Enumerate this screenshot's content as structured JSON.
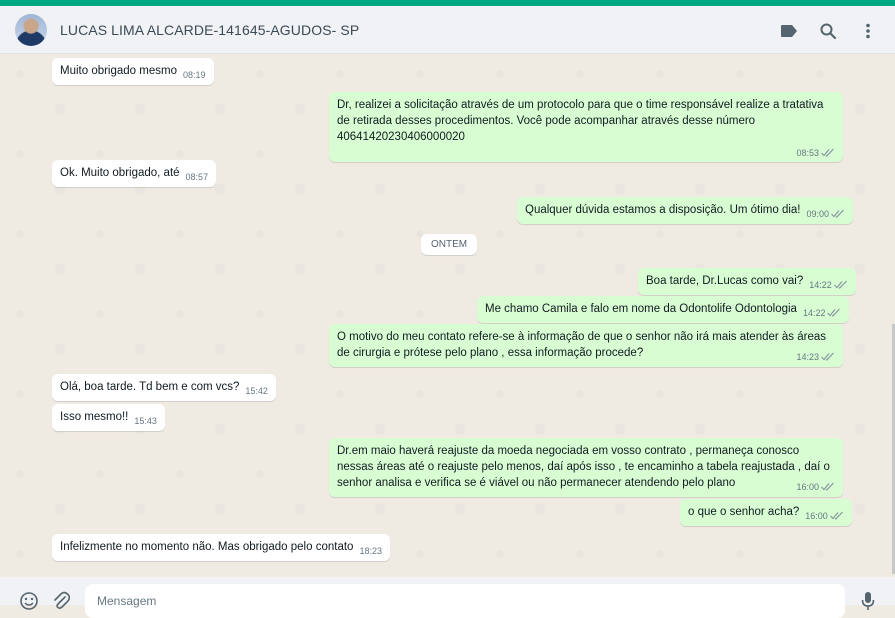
{
  "app": {
    "accent_color": "#00a884",
    "outgoing_bubble_color": "#d9fdd3",
    "incoming_bubble_color": "#ffffff"
  },
  "header": {
    "contact_name": "LUCAS LIMA ALCARDE-141645-AGUDOS- SP",
    "icons": [
      "label-icon",
      "search-icon",
      "menu-dots-icon"
    ]
  },
  "date_separator": "ONTEM",
  "messages": [
    {
      "direction": "in",
      "text": "Muito obrigado mesmo",
      "time": "08:19"
    },
    {
      "direction": "out",
      "text": "Dr, realizei a solicitação através de um protocolo para que o time responsável realize a tratativa de retirada desses procedimentos. Você pode acompanhar através desse número 40641420230406000020",
      "time": "08:53",
      "status": "read"
    },
    {
      "direction": "in",
      "text": "Ok. Muito obrigado, até",
      "time": "08:57"
    },
    {
      "direction": "out",
      "text": "Qualquer dúvida estamos a disposição. Um ótimo dia!",
      "time": "09:00",
      "status": "read"
    },
    {
      "direction": "out",
      "text": "Boa tarde, Dr.Lucas como vai?",
      "time": "14:22",
      "status": "read"
    },
    {
      "direction": "out",
      "text": "Me chamo Camila e falo em nome da Odontolife Odontologia",
      "time": "14:22",
      "status": "read"
    },
    {
      "direction": "out",
      "text": "O motivo do meu contato refere-se à informação de que o senhor não irá mais atender às áreas de cirurgia e prótese pelo plano , essa informação procede?",
      "time": "14:23",
      "status": "read"
    },
    {
      "direction": "in",
      "text": "Olá, boa tarde. Td bem e com vcs?",
      "time": "15:42"
    },
    {
      "direction": "in",
      "text": "Isso mesmo!!",
      "time": "15:43"
    },
    {
      "direction": "out",
      "text": "Dr.em maio haverá reajuste da moeda negociada em vosso contrato , permaneça conosco nessas áreas até o reajuste pelo menos, daí após isso , te encaminho a tabela reajustada , daí o senhor analisa e verifica se é viável ou não permanecer atendendo pelo plano",
      "time": "16:00",
      "status": "read"
    },
    {
      "direction": "out",
      "text": "o que o senhor acha?",
      "time": "16:00",
      "status": "read"
    },
    {
      "direction": "in",
      "text": "Infelizmente no momento não. Mas obrigado pelo contato",
      "time": "18:23"
    }
  ],
  "footer": {
    "placeholder": "Mensagem",
    "icons": [
      "emoji-icon",
      "attach-icon",
      "mic-icon"
    ]
  }
}
